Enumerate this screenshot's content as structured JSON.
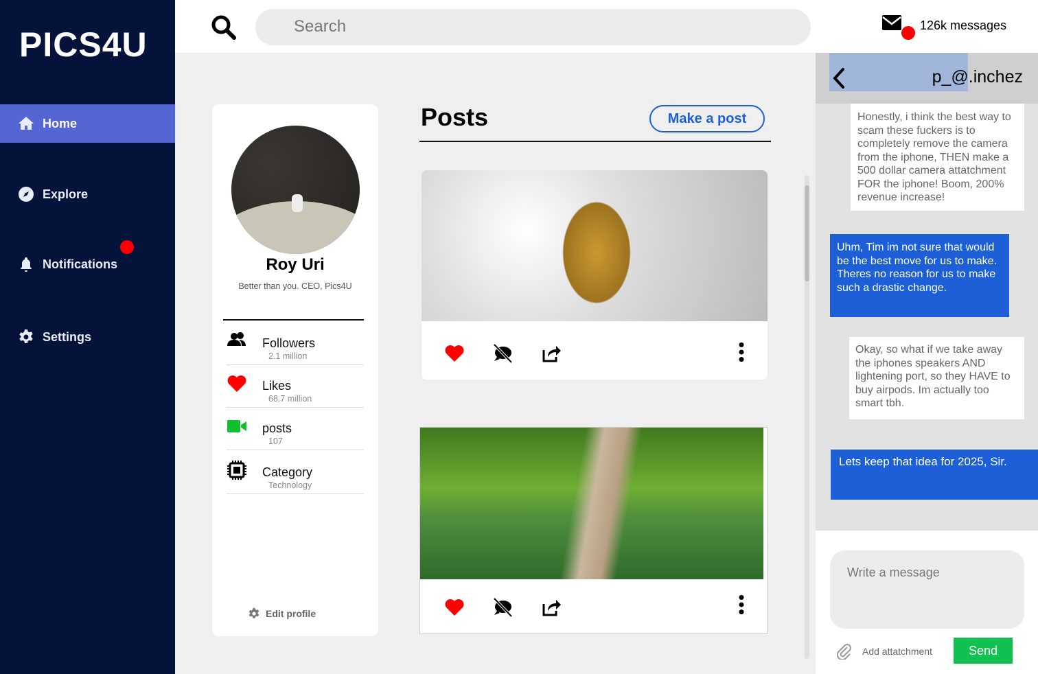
{
  "app": {
    "logo": "PICS4U"
  },
  "sidebar": {
    "items": [
      {
        "label": "Home",
        "icon": "home-icon"
      },
      {
        "label": "Explore",
        "icon": "compass-icon"
      },
      {
        "label": "Notifications",
        "icon": "bell-icon"
      },
      {
        "label": "Settings",
        "icon": "gear-icon"
      }
    ]
  },
  "search": {
    "placeholder": "Search"
  },
  "messages": {
    "count_label": "126k messages"
  },
  "profile": {
    "name": "Roy Uri",
    "bio": "Better than you. CEO, Pics4U",
    "edit_label": "Edit profile",
    "stats": [
      {
        "label": "Followers",
        "value": "2.1 million"
      },
      {
        "label": "Likes",
        "value": "68.7 million"
      },
      {
        "label": "posts",
        "value": "107"
      },
      {
        "label": "Category",
        "value": "Technology"
      }
    ]
  },
  "posts": {
    "title": "Posts",
    "make_post_label": "Make a post"
  },
  "chat": {
    "contact": "p_@.inchez",
    "messages": [
      {
        "from": "them",
        "text": "Honestly, i think the best way to scam these fuckers is to completely remove the camera from the iphone, THEN make a 500 dollar camera attatchment FOR the iphone! Boom, 200% revenue increase!"
      },
      {
        "from": "me",
        "text": "Uhm, Tim im not sure that would be the best move for us to make. Theres no reason for us to make such a drastic change."
      },
      {
        "from": "them",
        "text": "Okay, so what if we take away the iphones speakers AND lightening port, so they HAVE to buy airpods. Im actually too smart tbh."
      },
      {
        "from": "me",
        "text": "Lets keep that idea for 2025, Sir."
      }
    ],
    "input_placeholder": "Write a message",
    "attach_label": "Add attatchment",
    "send_label": "Send"
  },
  "colors": {
    "sidebar": "#05133a",
    "active": "#5465d4",
    "accent": "#1c5fd6",
    "send": "#10c050",
    "badge": "#ff0000"
  }
}
